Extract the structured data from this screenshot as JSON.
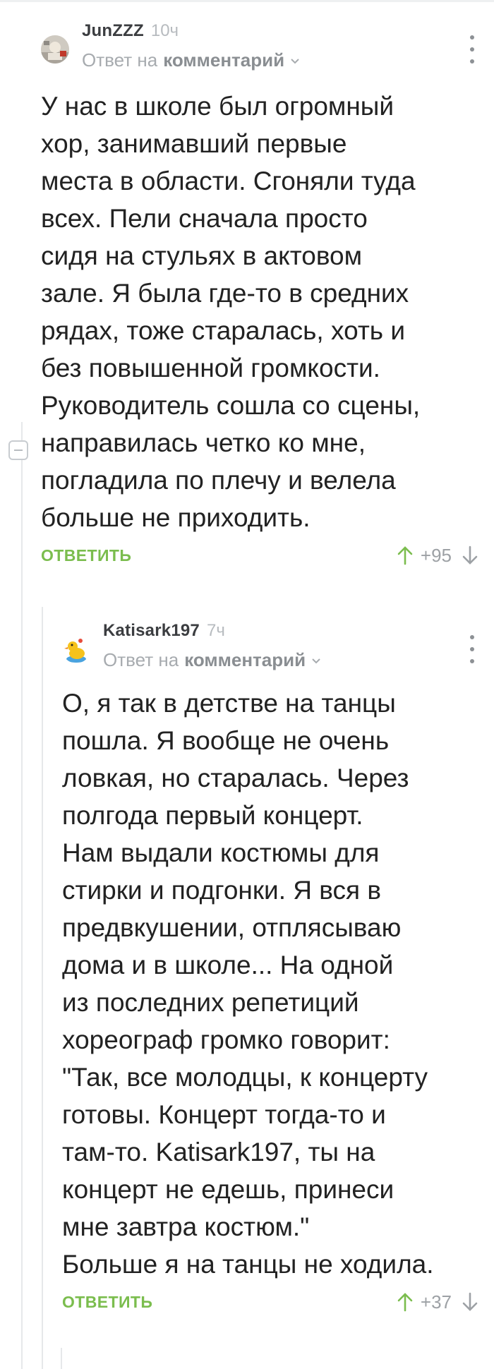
{
  "comments": [
    {
      "username": "JunZZZ",
      "time": "10ч",
      "reply_to_prefix": "Ответ на",
      "reply_to_target": "комментарий",
      "body": "У нас в школе был огромный\nхор, занимавший первые\nместа в области. Сгоняли туда\nвсех. Пели сначала просто\nсидя на стульях в актовом\nзале. Я была где-то в средних\nрядах, тоже старалась, хоть и\nбез повышенной громкости.\nРуководитель сошла со сцены,\nнаправилась четко ко мне,\nпогладила по плечу и велела\nбольше не приходить.",
      "reply_label": "ОТВЕТИТЬ",
      "score": "+95"
    },
    {
      "username": "Katisark197",
      "time": "7ч",
      "reply_to_prefix": "Ответ на",
      "reply_to_target": "комментарий",
      "body": "О, я так в детстве на танцы\nпошла. Я вообще не очень\nловкая, но старалась. Через\nполгода первый концерт.\nНам выдали костюмы для\nстирки и подгонки. Я вся в\nпредвкушении, отплясываю\nдома и в школе... На одной\nиз последних репетиций\nхореограф громко говорит:\n\"Так, все молодцы, к концерту\nготовы. Концерт тогда-то и\nтам-то. Katisark197, ты на\nконцерт не едешь, принеси\nмне завтра костюм.\"\nБольше я на танцы не ходила.",
      "reply_label": "ОТВЕТИТЬ",
      "score": "+37"
    }
  ],
  "colors": {
    "accent_green": "#7bbd4e",
    "muted_text": "#a7abaf",
    "body_text": "#222222"
  },
  "icons": [
    "avatar",
    "chevron-down-icon",
    "more-vertical-icon",
    "upvote-arrow-icon",
    "downvote-arrow-icon",
    "collapse-thread-icon"
  ]
}
